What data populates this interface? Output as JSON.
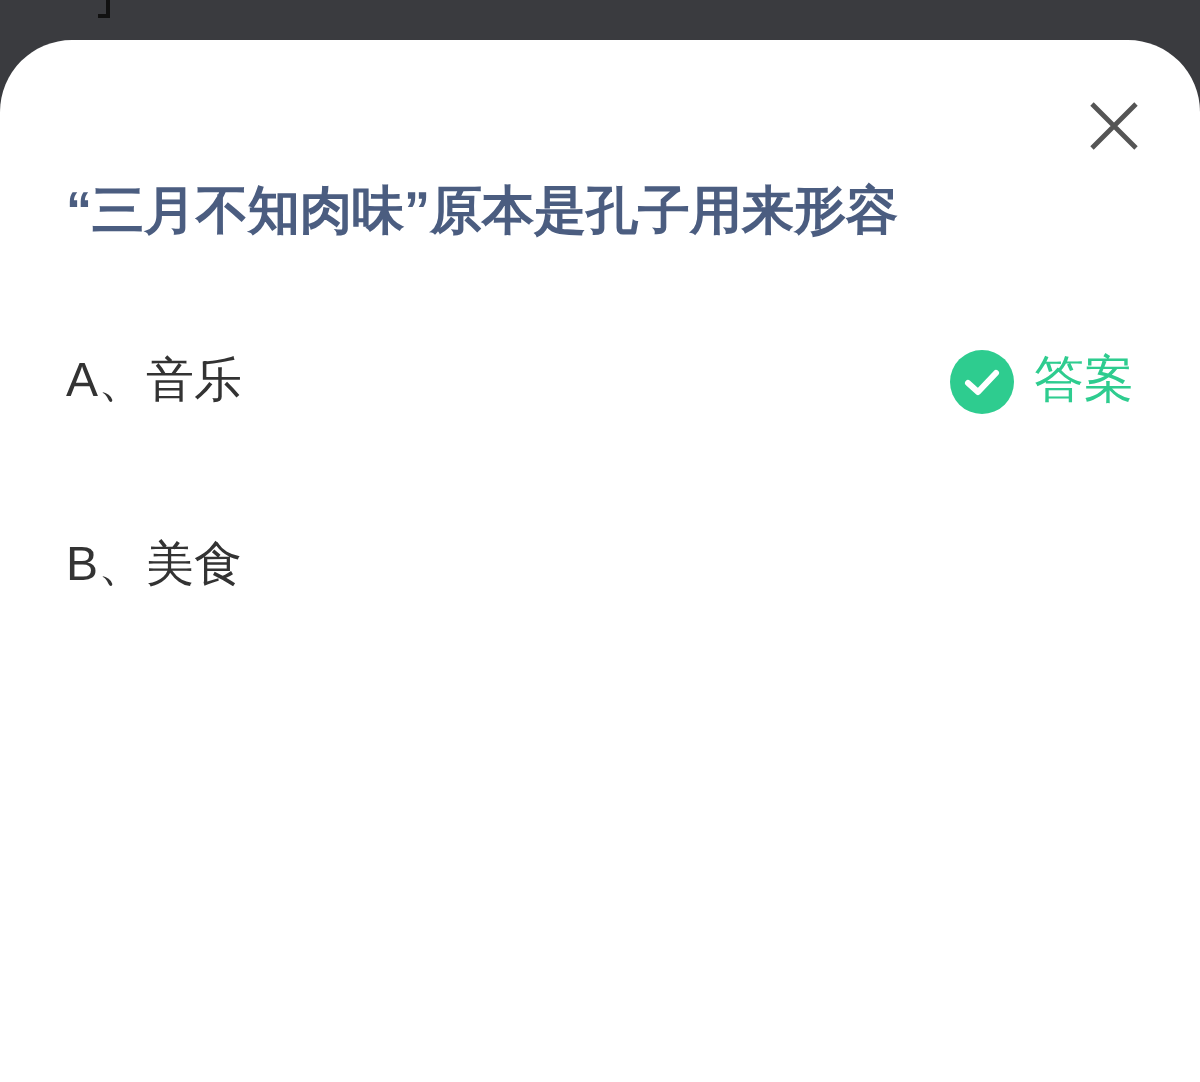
{
  "question": "“三月不知肉味”原本是孔子用来形容",
  "options": [
    {
      "label": "A、音乐",
      "is_answer": true,
      "answer_label": "答案"
    },
    {
      "label": "B、美食",
      "is_answer": false
    }
  ]
}
